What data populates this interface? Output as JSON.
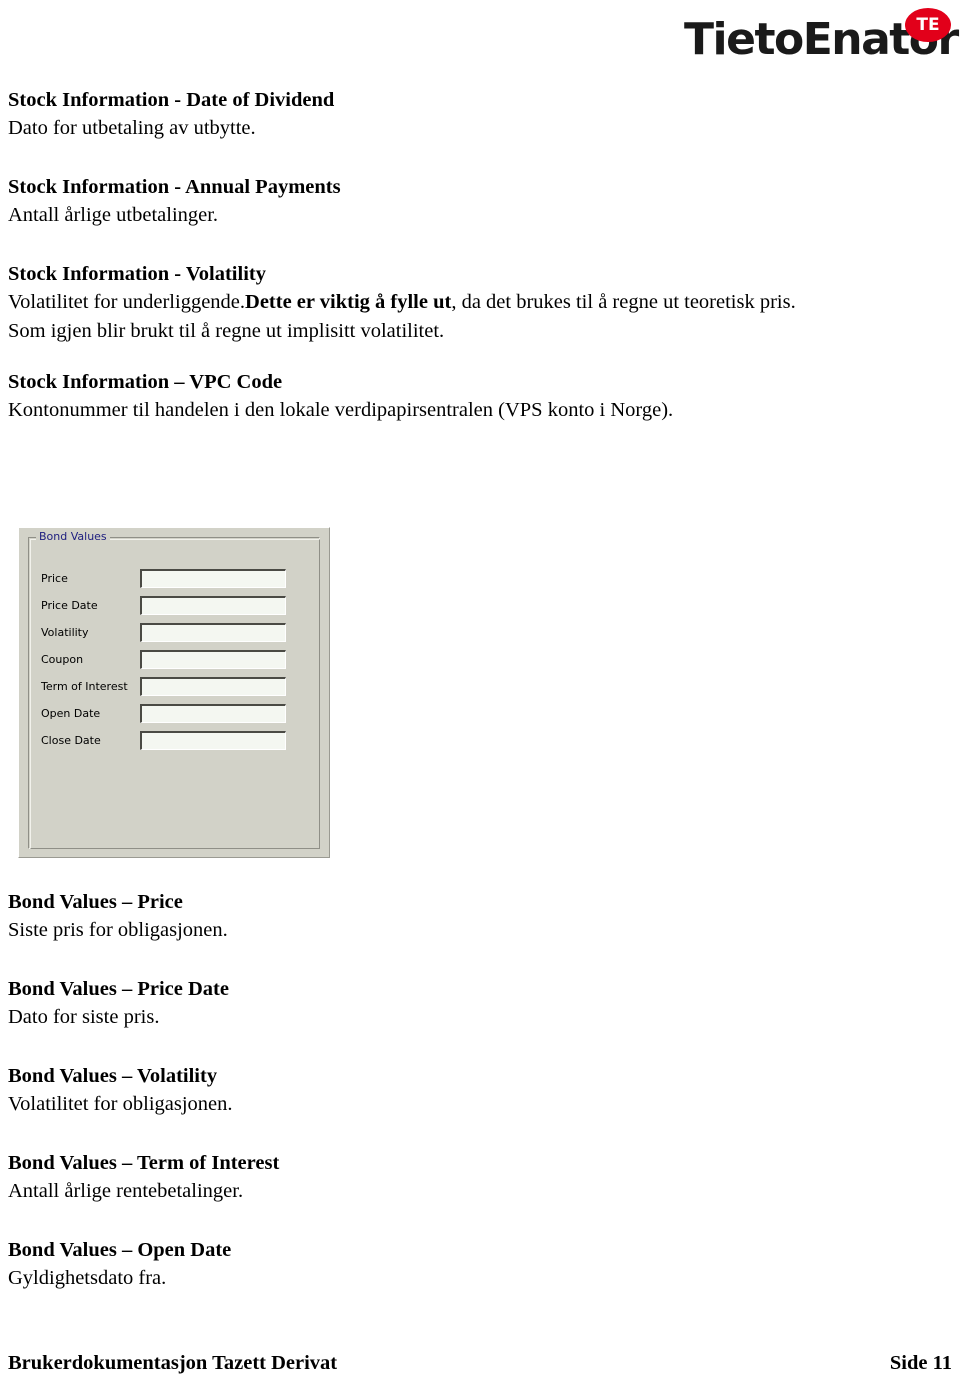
{
  "logo": {
    "wordmark": "TietoEnator",
    "badge_text": "TE",
    "badge_color": "#e2001a"
  },
  "sections": [
    {
      "heading": "Stock Information - Date of Dividend",
      "body": "Dato for utbetaling av utbytte."
    },
    {
      "heading": "Stock Information - Annual Payments",
      "body": "Antall årlige utbetalinger."
    },
    {
      "heading": "Stock Information - Volatility",
      "body_lead": "Volatilitet for underliggende.",
      "body_bold": "Dette er viktig å fylle ut",
      "body_rest": ", da det brukes til å regne ut teoretisk pris.",
      "body_line2": "Som igjen blir brukt til å regne ut implisitt volatilitet."
    },
    {
      "heading": "Stock Information – VPC Code",
      "body": "Kontonummer til handelen i den lokale verdipapirsentralen (VPS konto i Norge)."
    }
  ],
  "dialog": {
    "groupbox_title": "Bond Values",
    "legend_color": "#1d1d7e",
    "face_color": "#d2d2c8",
    "fields": [
      {
        "label": "Price",
        "value": ""
      },
      {
        "label": "Price Date",
        "value": ""
      },
      {
        "label": "Volatility",
        "value": ""
      },
      {
        "label": "Coupon",
        "value": ""
      },
      {
        "label": "Term of Interest",
        "value": ""
      },
      {
        "label": "Open Date",
        "value": ""
      },
      {
        "label": "Close Date",
        "value": ""
      }
    ]
  },
  "bond_sections": [
    {
      "heading": "Bond Values – Price",
      "body": "Siste pris for obligasjonen."
    },
    {
      "heading": "Bond Values – Price Date",
      "body": "Dato for siste pris."
    },
    {
      "heading": "Bond Values – Volatility",
      "body": "Volatilitet for obligasjonen."
    },
    {
      "heading": "Bond Values – Term of Interest",
      "body": "Antall årlige rentebetalinger."
    },
    {
      "heading": "Bond Values – Open Date",
      "body": "Gyldighetsdato fra."
    }
  ],
  "footer": {
    "left": "Brukerdokumentasjon Tazett Derivat",
    "right": "Side 11"
  }
}
